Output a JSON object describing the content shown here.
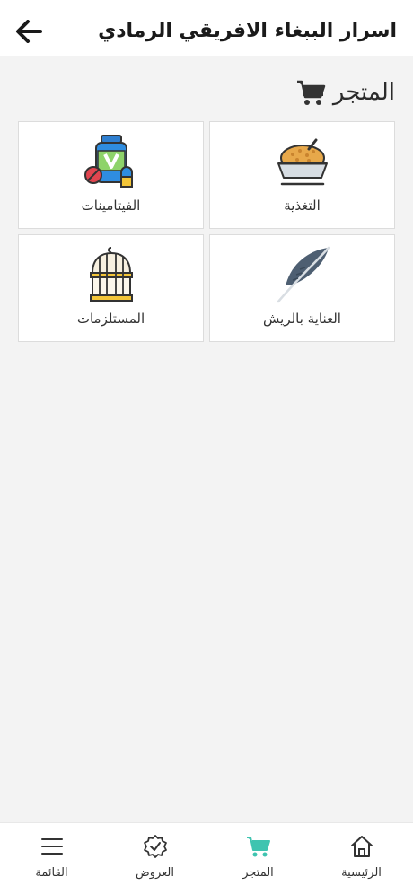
{
  "header": {
    "title": "اسرار الببغاء الافريقي الرمادي",
    "back_icon": "arrow-left-icon"
  },
  "section": {
    "title": "المتجر",
    "icon": "cart-icon"
  },
  "categories": [
    {
      "label": "التغذية",
      "icon": "food-bowl-icon"
    },
    {
      "label": "الفيتامينات",
      "icon": "vitamins-bottle-icon"
    },
    {
      "label": "العناية بالريش",
      "icon": "feather-icon"
    },
    {
      "label": "المستلزمات",
      "icon": "bird-cage-icon"
    }
  ],
  "nav": {
    "items": [
      {
        "label": "الرئيسية",
        "icon": "home-icon",
        "active": false
      },
      {
        "label": "المتجر",
        "icon": "cart-icon",
        "active": true
      },
      {
        "label": "العروض",
        "icon": "offer-badge-icon",
        "active": false
      },
      {
        "label": "القائمة",
        "icon": "menu-icon",
        "active": false
      }
    ],
    "active_color": "#3fc4b0"
  },
  "colors": {
    "background": "#f3f3f3",
    "card": "#ffffff",
    "accent": "#3fc4b0"
  }
}
